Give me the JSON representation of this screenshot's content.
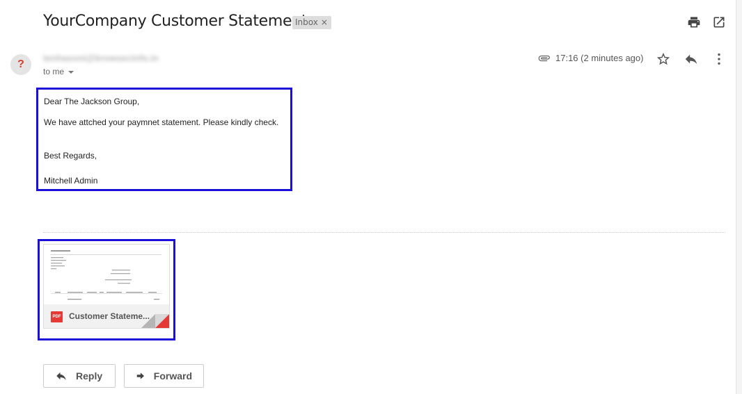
{
  "header": {
    "subject": "YourCompany Customer Statement",
    "label": "Inbox",
    "label_close": "×"
  },
  "sender": {
    "avatar": "?",
    "email": "tenhasoni@browsecinfo.in",
    "to_me": "to me",
    "time": "17:16 (2 minutes ago)"
  },
  "body": {
    "greeting": "Dear The Jackson Group,",
    "line1": "We have attched your paymnet statement. Please kindly check.",
    "regards": "Best Regards,",
    "signature": "Mitchell Admin"
  },
  "attachment": {
    "badge": "PDF",
    "name": "Customer Stateme..."
  },
  "actions": {
    "reply": "Reply",
    "forward": "Forward"
  },
  "icons": [
    "print-icon",
    "open-in-new-window-icon",
    "paperclip-icon",
    "star-icon",
    "reply-icon",
    "more-vert-icon",
    "pdf-icon"
  ],
  "colors": {
    "highlight": "#1a10d8",
    "avatar_question": "#d23f31",
    "pdf_red": "#e53935"
  }
}
